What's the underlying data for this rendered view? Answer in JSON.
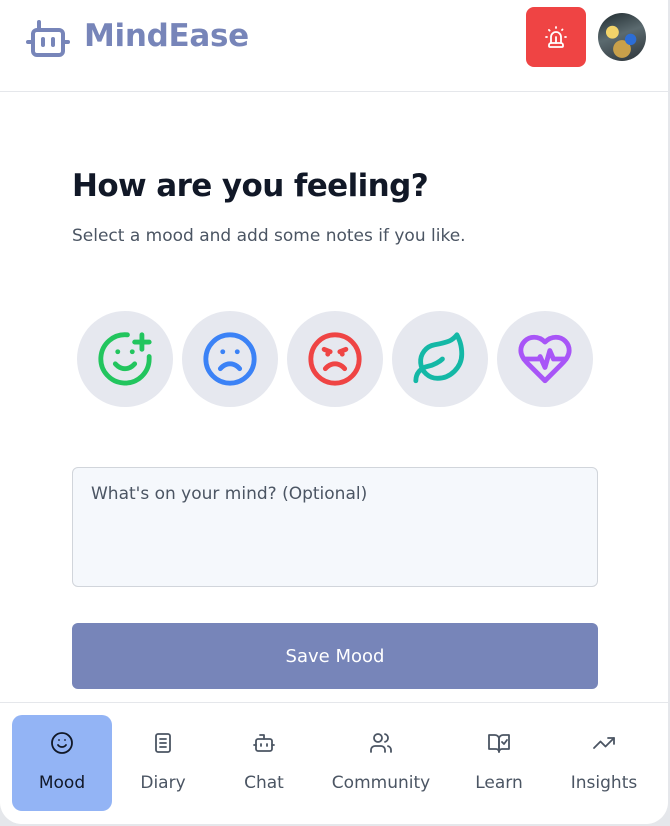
{
  "app": {
    "name": "MindEase"
  },
  "header": {
    "alert_icon": "siren-icon",
    "avatar": "user-avatar"
  },
  "main": {
    "title": "How are you feeling?",
    "subtitle": "Select a mood and add some notes if you like.",
    "moods": [
      {
        "icon": "smile-plus-icon",
        "color": "#22c55e"
      },
      {
        "icon": "frown-icon",
        "color": "#3b82f6"
      },
      {
        "icon": "angry-icon",
        "color": "#ef4444"
      },
      {
        "icon": "leaf-icon",
        "color": "#14b8a6"
      },
      {
        "icon": "heart-pulse-icon",
        "color": "#a855f7"
      }
    ],
    "notes_placeholder": "What's on your mind? (Optional)",
    "notes_value": "",
    "save_label": "Save Mood"
  },
  "nav": {
    "items": [
      {
        "label": "Mood",
        "icon": "smile-icon",
        "active": true
      },
      {
        "label": "Diary",
        "icon": "notebook-icon",
        "active": false
      },
      {
        "label": "Chat",
        "icon": "bot-icon",
        "active": false
      },
      {
        "label": "Community",
        "icon": "users-icon",
        "active": false
      },
      {
        "label": "Learn",
        "icon": "book-check-icon",
        "active": false
      },
      {
        "label": "Insights",
        "icon": "trending-up-icon",
        "active": false
      }
    ]
  },
  "colors": {
    "brand": "#7785b9",
    "alert": "#ef4444",
    "active_nav": "#93b4f5",
    "mood_bg": "#e6e8ef"
  }
}
